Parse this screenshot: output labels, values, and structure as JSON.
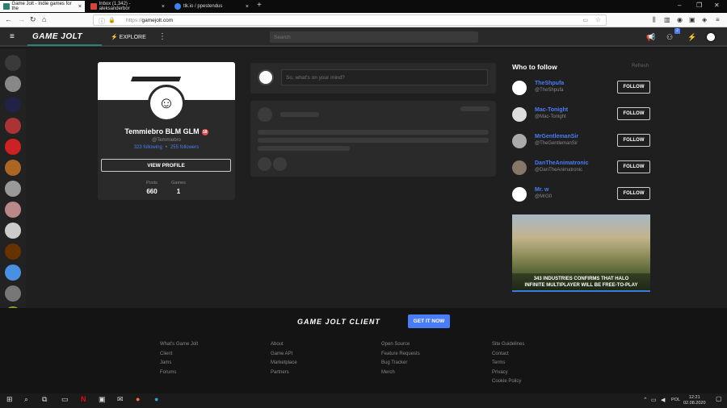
{
  "browser": {
    "tabs": [
      {
        "title": "Game Jolt - Indie games for the"
      },
      {
        "title": "Inbox (1,342) - aleksanderbor"
      },
      {
        "title": "tlk.io / ppestendus"
      }
    ],
    "url_protocol": "https://",
    "url_host": "gamejolt.com"
  },
  "gj": {
    "logo": "GAME JOLT",
    "explore_label": "EXPLORE",
    "search_placeholder": "Search",
    "notification_count": "2"
  },
  "profile": {
    "name": "Temmiebro BLM GLM",
    "badge": "18",
    "handle": "@Temmiebro",
    "following": "323 following",
    "followers": "255 followers",
    "view_profile_label": "VIEW PROFILE",
    "stats": [
      {
        "label": "Posts",
        "value": "660"
      },
      {
        "label": "Games",
        "value": "1"
      }
    ]
  },
  "feed": {
    "composer_placeholder": "So, what's on your mind?"
  },
  "who_to_follow": {
    "title": "Who to follow",
    "refresh": "Refresh",
    "users": [
      {
        "name": "TheShpufa",
        "handle": "@TheShpufa",
        "button": "FOLLOW"
      },
      {
        "name": "Mac-Tonight",
        "handle": "@Mac-Tonight",
        "button": "FOLLOW"
      },
      {
        "name": "MrGentlemanSir",
        "handle": "@TheGentlemanSir",
        "button": "FOLLOW"
      },
      {
        "name": "DanTheAnimatronic",
        "handle": "@DanTheAnimatronic",
        "button": "FOLLOW"
      },
      {
        "name": "Mr. w",
        "handle": "@MrG0",
        "button": "FOLLOW"
      }
    ]
  },
  "ad": {
    "line1": "343 INDUSTRIES CONFIRMS THAT HALO",
    "line2": "INFINITE MULTIPLAYER WILL BE FREE-TO-PLAY"
  },
  "footer": {
    "client_logo": "GAME JOLT CLIENT",
    "get_it_label": "GET IT NOW",
    "columns": [
      [
        "What's Game Jolt",
        "Client",
        "Jams",
        "Forums"
      ],
      [
        "About",
        "Game API",
        "Marketplace",
        "Partners"
      ],
      [
        "Open Source",
        "Feature Requests",
        "Bug Tracker",
        "Merch"
      ],
      [
        "Site Guidelines",
        "Contact",
        "Terms",
        "Privacy",
        "Cookie Policy"
      ]
    ]
  },
  "taskbar": {
    "lang": "POL",
    "time": "12:21",
    "date": "02.08.2020",
    "sidebar_badge": "2"
  }
}
